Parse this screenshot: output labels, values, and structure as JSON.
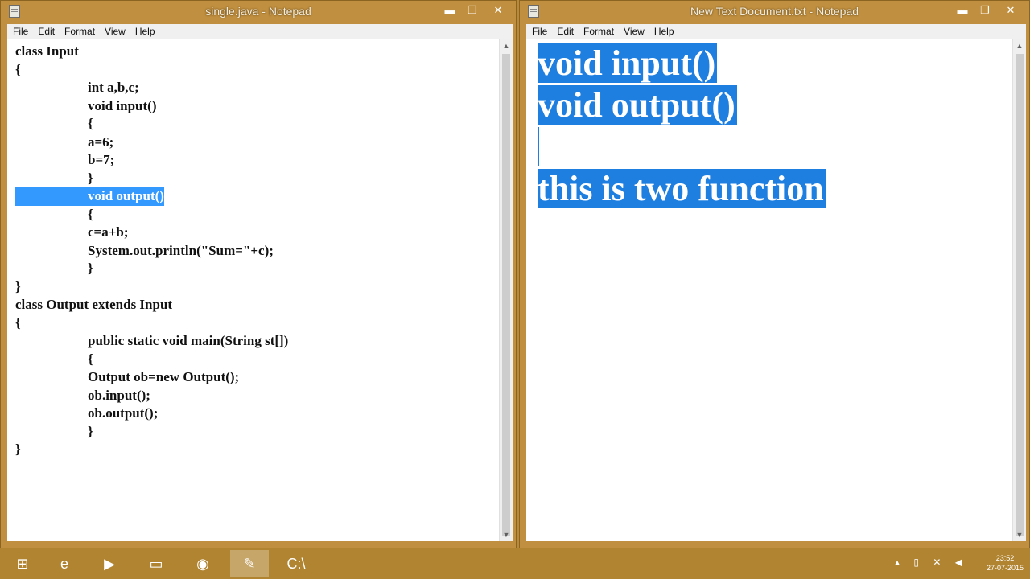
{
  "left_window": {
    "title": "single.java - Notepad",
    "controls": {
      "minimize": "▬",
      "maximize": "❐",
      "close": "✕"
    },
    "menu": [
      "File",
      "Edit",
      "Format",
      "View",
      "Help"
    ],
    "code_lines": [
      {
        "text": "class Input",
        "indent": false,
        "selected": false
      },
      {
        "text": "{",
        "indent": false,
        "selected": false
      },
      {
        "text": "int a,b,c;",
        "indent": true,
        "selected": false
      },
      {
        "text": "void input()",
        "indent": true,
        "selected": false
      },
      {
        "text": "{",
        "indent": true,
        "selected": false
      },
      {
        "text": "a=6;",
        "indent": true,
        "selected": false
      },
      {
        "text": "b=7;",
        "indent": true,
        "selected": false
      },
      {
        "text": "}",
        "indent": true,
        "selected": false
      },
      {
        "text": "void output()",
        "indent": true,
        "selected": true
      },
      {
        "text": "{",
        "indent": true,
        "selected": false
      },
      {
        "text": "c=a+b;",
        "indent": true,
        "selected": false
      },
      {
        "text": "System.out.println(\"Sum=\"+c);",
        "indent": true,
        "selected": false
      },
      {
        "text": "}",
        "indent": true,
        "selected": false
      },
      {
        "text": "}",
        "indent": false,
        "selected": false
      },
      {
        "text": "class Output extends Input",
        "indent": false,
        "selected": false
      },
      {
        "text": "{",
        "indent": false,
        "selected": false
      },
      {
        "text": "public static void main(String st[])",
        "indent": true,
        "selected": false
      },
      {
        "text": "{",
        "indent": true,
        "selected": false
      },
      {
        "text": "Output ob=new Output();",
        "indent": true,
        "selected": false
      },
      {
        "text": "ob.input();",
        "indent": true,
        "selected": false
      },
      {
        "text": "ob.output();",
        "indent": true,
        "selected": false
      },
      {
        "text": "}",
        "indent": true,
        "selected": false
      },
      {
        "text": "}",
        "indent": false,
        "selected": false
      }
    ]
  },
  "right_window": {
    "title": "New Text Document.txt - Notepad",
    "controls": {
      "minimize": "▬",
      "maximize": "❐",
      "close": "✕"
    },
    "menu": [
      "File",
      "Edit",
      "Format",
      "View",
      "Help"
    ],
    "lines": [
      "void input()",
      "void output()",
      "",
      "this is two function"
    ]
  },
  "taskbar": {
    "apps": [
      {
        "name": "start",
        "glyph": "⊞"
      },
      {
        "name": "internet-explorer",
        "glyph": "e"
      },
      {
        "name": "media-player",
        "glyph": "▶"
      },
      {
        "name": "file-explorer",
        "glyph": "▭"
      },
      {
        "name": "chrome",
        "glyph": "◉"
      },
      {
        "name": "notepad",
        "glyph": "✎"
      },
      {
        "name": "command-prompt",
        "glyph": "C:\\"
      }
    ],
    "clock_time": "23:52",
    "clock_date": "27-07-2015"
  }
}
